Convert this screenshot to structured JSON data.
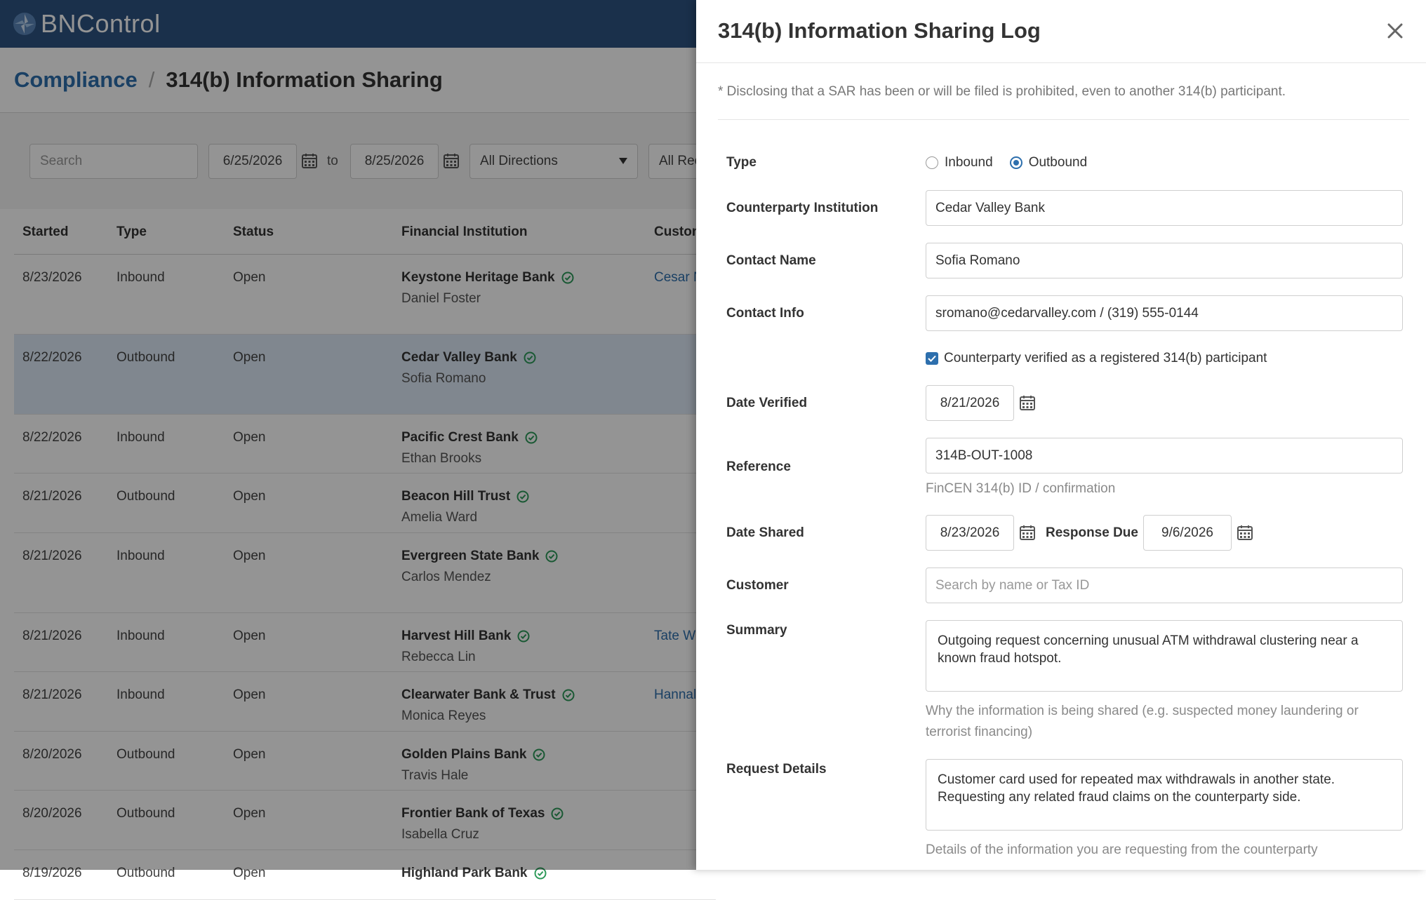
{
  "app": {
    "name": "BNControl"
  },
  "breadcrumb": {
    "parent": "Compliance",
    "current": "314(b) Information Sharing"
  },
  "filters": {
    "search_placeholder": "Search",
    "date_from": "6/25/2026",
    "to_label": "to",
    "date_to": "8/25/2026",
    "direction": "All Directions",
    "records": "All Rec"
  },
  "table": {
    "headers": [
      "Started",
      "Type",
      "Status",
      "Financial Institution",
      "Custon"
    ],
    "rows": [
      {
        "started": "8/23/2026",
        "type": "Inbound",
        "status": "Open",
        "fi": "Keystone Heritage Bank",
        "contact": "Daniel Foster",
        "customer": "Cesar N"
      },
      {
        "started": "8/22/2026",
        "type": "Outbound",
        "status": "Open",
        "fi": "Cedar Valley Bank",
        "contact": "Sofia Romano",
        "customer": ""
      },
      {
        "started": "8/22/2026",
        "type": "Inbound",
        "status": "Open",
        "fi": "Pacific Crest Bank",
        "contact": "Ethan Brooks",
        "customer": ""
      },
      {
        "started": "8/21/2026",
        "type": "Outbound",
        "status": "Open",
        "fi": "Beacon Hill Trust",
        "contact": "Amelia Ward",
        "customer": ""
      },
      {
        "started": "8/21/2026",
        "type": "Inbound",
        "status": "Open",
        "fi": "Evergreen State Bank",
        "contact": "Carlos Mendez",
        "customer": ""
      },
      {
        "started": "8/21/2026",
        "type": "Inbound",
        "status": "Open",
        "fi": "Harvest Hill Bank",
        "contact": "Rebecca Lin",
        "customer": "Tate W"
      },
      {
        "started": "8/21/2026",
        "type": "Inbound",
        "status": "Open",
        "fi": "Clearwater Bank & Trust",
        "contact": "Monica Reyes",
        "customer": "Hannal"
      },
      {
        "started": "8/20/2026",
        "type": "Outbound",
        "status": "Open",
        "fi": "Golden Plains Bank",
        "contact": "Travis Hale",
        "customer": ""
      },
      {
        "started": "8/20/2026",
        "type": "Outbound",
        "status": "Open",
        "fi": "Frontier Bank of Texas",
        "contact": "Isabella Cruz",
        "customer": ""
      },
      {
        "started": "8/19/2026",
        "type": "Outbound",
        "status": "Open",
        "fi": "Highland Park Bank",
        "contact": "",
        "customer": ""
      }
    ]
  },
  "panel": {
    "title": "314(b) Information Sharing Log",
    "notice": "* Disclosing that a SAR has been or will be filed is prohibited, even to another 314(b) participant.",
    "type_label": "Type",
    "type_inbound": "Inbound",
    "type_outbound": "Outbound",
    "counterparty_label": "Counterparty Institution",
    "counterparty_value": "Cedar Valley Bank",
    "contact_name_label": "Contact Name",
    "contact_name_value": "Sofia Romano",
    "contact_info_label": "Contact Info",
    "contact_info_value": "sromano@cedarvalley.com / (319) 555-0144",
    "verified_label": "Counterparty verified as a registered 314(b) participant",
    "date_verified_label": "Date Verified",
    "date_verified_value": "8/21/2026",
    "reference_label": "Reference",
    "reference_value": "314B-OUT-1008",
    "reference_help": "FinCEN 314(b) ID / confirmation",
    "date_shared_label": "Date Shared",
    "date_shared_value": "8/23/2026",
    "response_due_label": "Response Due",
    "response_due_value": "9/6/2026",
    "customer_label": "Customer",
    "customer_placeholder": "Search by name or Tax ID",
    "summary_label": "Summary",
    "summary_value": "Outgoing request concerning unusual ATM withdrawal clustering near a known fraud hotspot.",
    "summary_help": "Why the information is being shared (e.g. suspected money laundering or terrorist financing)",
    "request_label": "Request Details",
    "request_value": "Customer card used for repeated max withdrawals in another state. Requesting any related fraud claims on the counterparty side.",
    "request_help": "Details of the information you are requesting from the counterparty"
  },
  "colors": {
    "brand": "#2d5482",
    "link": "#2d6fad",
    "verified": "#2e9a5a"
  }
}
